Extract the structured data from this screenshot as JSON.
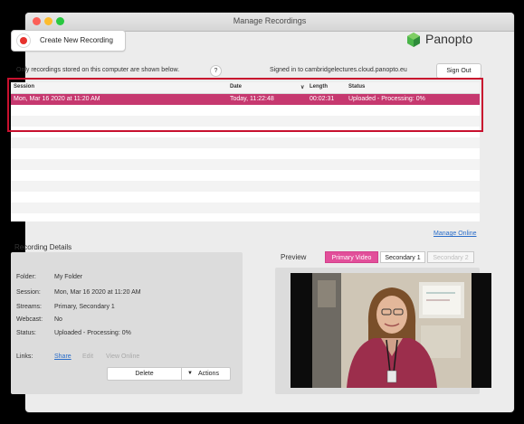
{
  "window": {
    "title": "Manage Recordings"
  },
  "toolbar": {
    "create_label": "Create New Recording",
    "logo_text": "Panopto"
  },
  "notice": {
    "text": "Only recordings stored on this computer are shown below.",
    "help": "?"
  },
  "account": {
    "signed_in_text": "Signed in to cambridgelectures.cloud.panopto.eu",
    "sign_out_label": "Sign Out"
  },
  "table": {
    "headers": {
      "session": "Session",
      "date": "Date",
      "sort_indicator": "∨",
      "length": "Length",
      "status": "Status"
    },
    "rows": [
      {
        "session": "Mon, Mar 16 2020 at 11:20 AM",
        "date": "Today, 11:22:48",
        "length": "00:02:31",
        "status": "Uploaded - Processing: 0%"
      }
    ]
  },
  "links": {
    "manage_online": "Manage Online"
  },
  "details": {
    "title": "Recording Details",
    "folder_label": "Folder:",
    "folder_value": "My Folder",
    "session_label": "Session:",
    "session_value": "Mon, Mar 16 2020 at 11:20 AM",
    "streams_label": "Streams:",
    "streams_value": "Primary, Secondary 1",
    "webcast_label": "Webcast:",
    "webcast_value": "No",
    "status_label": "Status:",
    "status_value": "Uploaded - Processing: 0%",
    "links_label": "Links:",
    "share": "Share",
    "edit": "Edit",
    "view_online": "View Online",
    "delete_label": "Delete",
    "actions_label": "Actions"
  },
  "preview": {
    "title": "Preview",
    "tabs": [
      "Primary Video",
      "Secondary 1",
      "Secondary 2"
    ]
  },
  "colors": {
    "accent": "#c6386f",
    "tab_active": "#e24f9a",
    "link": "#2a6dc9",
    "highlight": "#c8102e"
  }
}
